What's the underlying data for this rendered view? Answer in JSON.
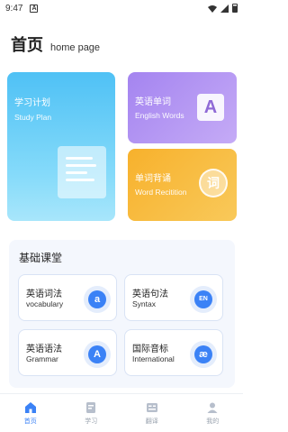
{
  "status": {
    "time": "9:47",
    "notif": "A"
  },
  "header": {
    "title": "首页",
    "subtitle": "home page"
  },
  "cards": {
    "study": {
      "title": "学习计划",
      "sub": "Study Plan"
    },
    "english": {
      "title": "英语单词",
      "sub": "English Words",
      "tile": "A"
    },
    "recite": {
      "title": "单词背诵",
      "sub": "Word Recitition",
      "badge": "词"
    }
  },
  "classroom": {
    "title": "基础课堂",
    "items": [
      {
        "zh": "英语词法",
        "en": "vocabulary",
        "icon": "a"
      },
      {
        "zh": "英语句法",
        "en": "Syntax",
        "icon": "EN"
      },
      {
        "zh": "英语语法",
        "en": "Grammar",
        "icon": "A"
      },
      {
        "zh": "国际音标",
        "en": "International",
        "icon": "æ"
      }
    ]
  },
  "tabs": [
    {
      "label": "首页",
      "icon": "home-icon",
      "active": true
    },
    {
      "label": "学习",
      "icon": "book-icon",
      "active": false
    },
    {
      "label": "翻译",
      "icon": "translate-icon",
      "active": false
    },
    {
      "label": "我的",
      "icon": "user-icon",
      "active": false
    }
  ],
  "colors": {
    "accent": "#3b82f6",
    "study": "#4fc1f5",
    "english": "#a484f0",
    "recite": "#f7b12c"
  }
}
